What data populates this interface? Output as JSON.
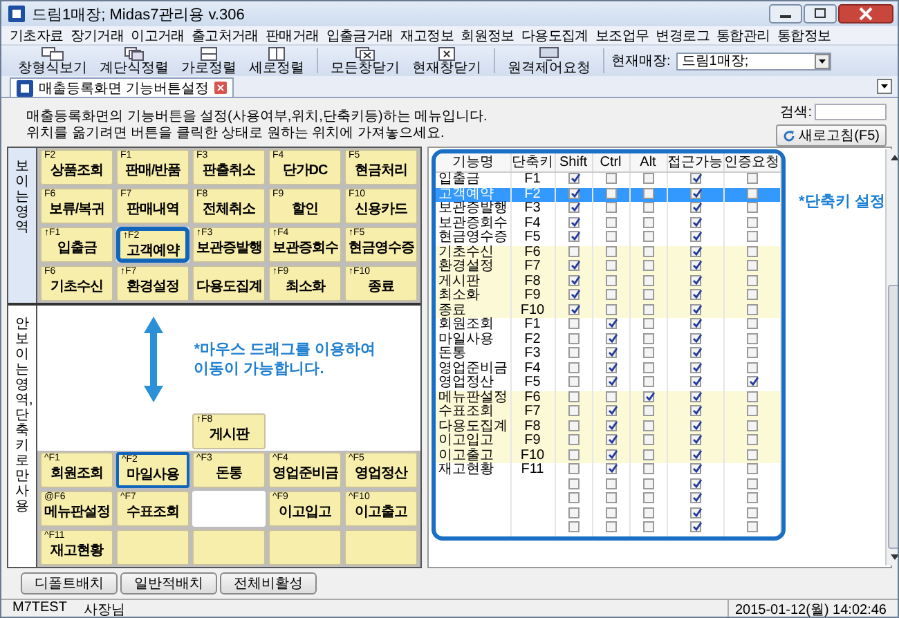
{
  "window": {
    "title": "드림1매장; Midas7관리용 v.306"
  },
  "menu": [
    "기초자료",
    "장기거래",
    "이고거래",
    "출고처거래",
    "판매거래",
    "입출금거래",
    "재고정보",
    "회원정보",
    "다용도집계",
    "보조업무",
    "변경로그",
    "통합관리",
    "통합정보"
  ],
  "toolbar": {
    "groups": [
      [
        "창형식보기",
        "계단식정렬",
        "가로정렬",
        "세로정렬"
      ],
      [
        "모든창닫기",
        "현재창닫기"
      ],
      [
        "원격제어요청"
      ]
    ],
    "store_label": "현재매장:",
    "store_value": "드림1매장;"
  },
  "tab": {
    "title": "매출등록화면 기능버튼설정"
  },
  "description": [
    "매출등록화면의 기능버튼을 설정(사용여부,위치,단축키등)하는 메뉴입니다.",
    "위치를 옮기려면 버튼을 클릭한 상태로 원하는 위치에 가져놓으세요."
  ],
  "search": {
    "label": "검색:"
  },
  "refresh_button": "새로고침(F5)",
  "visible_area": {
    "label": "보이는 영역",
    "rows": [
      [
        {
          "kind": "button",
          "key": "F2",
          "label": "상품조회",
          "selected": false
        },
        {
          "kind": "button",
          "key": "F1",
          "label": "판매/반품",
          "selected": false
        },
        {
          "kind": "button",
          "key": "F3",
          "label": "판출취소",
          "selected": false
        },
        {
          "kind": "button",
          "key": "F4",
          "label": "단가DC",
          "selected": false
        },
        {
          "kind": "button",
          "key": "F5",
          "label": "현금처리",
          "selected": false
        }
      ],
      [
        {
          "kind": "button",
          "key": "F6",
          "label": "보류/복귀",
          "selected": false
        },
        {
          "kind": "button",
          "key": "F7",
          "label": "판매내역",
          "selected": false
        },
        {
          "kind": "button",
          "key": "F8",
          "label": "전체취소",
          "selected": false
        },
        {
          "kind": "button",
          "key": "F9",
          "label": "할인",
          "selected": false
        },
        {
          "kind": "button",
          "key": "F10",
          "label": "신용카드",
          "selected": false
        }
      ],
      [
        {
          "kind": "button",
          "key": "↑F1",
          "label": "입출금",
          "selected": false
        },
        {
          "kind": "target"
        },
        {
          "kind": "button",
          "key": "↑F3",
          "label": "보관증발행",
          "selected": false
        },
        {
          "kind": "button",
          "key": "↑F4",
          "label": "보관증회수",
          "selected": false
        },
        {
          "kind": "button",
          "key": "↑F5",
          "label": "현금영수증",
          "selected": false
        }
      ],
      [
        {
          "kind": "button",
          "key": "F6",
          "label": "기초수신",
          "selected": false
        },
        {
          "kind": "button",
          "key": "↑F7",
          "label": "환경설정",
          "selected": false
        },
        {
          "kind": "button",
          "label": "다용도집계",
          "selected": false
        },
        {
          "kind": "button",
          "key": "↑F9",
          "label": "최소화",
          "selected": false
        },
        {
          "kind": "button",
          "key": "↑F10",
          "label": "종료",
          "selected": false
        }
      ]
    ]
  },
  "dragging_card": {
    "key": "↑F2",
    "label": "고객예약"
  },
  "hidden_area": {
    "label": "안보이는 영역, 단축키로만 사용",
    "hint": "*마우스 드래그를 이용하여 이동이 가능합니다.",
    "rows": [
      [
        {
          "kind": "blank"
        },
        {
          "kind": "blank"
        },
        {
          "kind": "button",
          "key": "↑F8",
          "label": "게시판",
          "selected": false
        },
        {
          "kind": "blank"
        },
        {
          "kind": "blank"
        }
      ],
      [
        {
          "kind": "button",
          "key": "^F1",
          "label": "회원조회",
          "selected": false
        },
        {
          "kind": "button",
          "key": "^F2",
          "label": "마일사용",
          "selected": true
        },
        {
          "kind": "button",
          "key": "^F3",
          "label": "돈통",
          "selected": false
        },
        {
          "kind": "button",
          "key": "^F4",
          "label": "영업준비금",
          "selected": false
        },
        {
          "kind": "button",
          "key": "^F5",
          "label": "영업정산",
          "selected": false
        }
      ],
      [
        {
          "kind": "button",
          "key": "@F6",
          "label": "메뉴판설정",
          "selected": false
        },
        {
          "kind": "button",
          "key": "^F7",
          "label": "수표조회",
          "selected": false
        },
        {
          "kind": "blank"
        },
        {
          "kind": "button",
          "key": "^F9",
          "label": "이고입고",
          "selected": false
        },
        {
          "kind": "button",
          "key": "^F10",
          "label": "이고출고",
          "selected": false
        }
      ],
      [
        {
          "kind": "button",
          "key": "^F11",
          "label": "재고현황",
          "selected": false
        },
        {
          "kind": "empty"
        },
        {
          "kind": "empty"
        },
        {
          "kind": "empty"
        },
        {
          "kind": "empty"
        }
      ]
    ]
  },
  "shortcut_table": {
    "columns": [
      "기능명",
      "단축키",
      "Shift",
      "Ctrl",
      "Alt",
      "접근가능",
      "인증요청"
    ],
    "note": "*단축키 설정",
    "rows": [
      {
        "name": "입출금",
        "key": "F1",
        "shift": true,
        "ctrl": false,
        "alt": false,
        "access": true,
        "auth": false,
        "highlighted": false,
        "selected": false
      },
      {
        "name": "고객예약",
        "key": "F2",
        "shift": true,
        "ctrl": false,
        "alt": false,
        "access": true,
        "auth": false,
        "highlighted": false,
        "selected": true
      },
      {
        "name": "보관증발행",
        "key": "F3",
        "shift": true,
        "ctrl": false,
        "alt": false,
        "access": true,
        "auth": false,
        "highlighted": false,
        "selected": false
      },
      {
        "name": "보관증회수",
        "key": "F4",
        "shift": true,
        "ctrl": false,
        "alt": false,
        "access": true,
        "auth": false,
        "highlighted": false,
        "selected": false
      },
      {
        "name": "현금영수증",
        "key": "F5",
        "shift": true,
        "ctrl": false,
        "alt": false,
        "access": true,
        "auth": false,
        "highlighted": false,
        "selected": false
      },
      {
        "name": "기초수신",
        "key": "F6",
        "shift": false,
        "ctrl": false,
        "alt": false,
        "access": true,
        "auth": false,
        "highlighted": true,
        "selected": false
      },
      {
        "name": "환경설정",
        "key": "F7",
        "shift": true,
        "ctrl": false,
        "alt": false,
        "access": true,
        "auth": false,
        "highlighted": true,
        "selected": false
      },
      {
        "name": "게시판",
        "key": "F8",
        "shift": true,
        "ctrl": false,
        "alt": false,
        "access": true,
        "auth": false,
        "highlighted": true,
        "selected": false
      },
      {
        "name": "최소화",
        "key": "F9",
        "shift": true,
        "ctrl": false,
        "alt": false,
        "access": true,
        "auth": false,
        "highlighted": true,
        "selected": false
      },
      {
        "name": "종료",
        "key": "F10",
        "shift": true,
        "ctrl": false,
        "alt": false,
        "access": true,
        "auth": false,
        "highlighted": true,
        "selected": false
      },
      {
        "name": "회원조회",
        "key": "F1",
        "shift": false,
        "ctrl": true,
        "alt": false,
        "access": true,
        "auth": false,
        "highlighted": false,
        "selected": false
      },
      {
        "name": "마일사용",
        "key": "F2",
        "shift": false,
        "ctrl": true,
        "alt": false,
        "access": true,
        "auth": false,
        "highlighted": false,
        "selected": false
      },
      {
        "name": "돈통",
        "key": "F3",
        "shift": false,
        "ctrl": true,
        "alt": false,
        "access": true,
        "auth": false,
        "highlighted": false,
        "selected": false
      },
      {
        "name": "영업준비금",
        "key": "F4",
        "shift": false,
        "ctrl": true,
        "alt": false,
        "access": true,
        "auth": false,
        "highlighted": false,
        "selected": false
      },
      {
        "name": "영업정산",
        "key": "F5",
        "shift": false,
        "ctrl": true,
        "alt": false,
        "access": true,
        "auth": true,
        "highlighted": false,
        "selected": false
      },
      {
        "name": "메뉴판설정",
        "key": "F6",
        "shift": false,
        "ctrl": false,
        "alt": true,
        "access": true,
        "auth": false,
        "highlighted": true,
        "selected": false
      },
      {
        "name": "수표조회",
        "key": "F7",
        "shift": false,
        "ctrl": true,
        "alt": false,
        "access": true,
        "auth": false,
        "highlighted": true,
        "selected": false
      },
      {
        "name": "다용도집계",
        "key": "F8",
        "shift": false,
        "ctrl": true,
        "alt": false,
        "access": true,
        "auth": false,
        "highlighted": true,
        "selected": false
      },
      {
        "name": "이고입고",
        "key": "F9",
        "shift": false,
        "ctrl": true,
        "alt": false,
        "access": true,
        "auth": false,
        "highlighted": true,
        "selected": false
      },
      {
        "name": "이고출고",
        "key": "F10",
        "shift": false,
        "ctrl": true,
        "alt": false,
        "access": true,
        "auth": false,
        "highlighted": true,
        "selected": false
      },
      {
        "name": "재고현황",
        "key": "F11",
        "shift": false,
        "ctrl": true,
        "alt": false,
        "access": true,
        "auth": false,
        "highlighted": false,
        "selected": false
      },
      {
        "shift": false,
        "ctrl": false,
        "alt": false,
        "access": true,
        "auth": false,
        "highlighted": false,
        "selected": false
      },
      {
        "shift": false,
        "ctrl": false,
        "alt": false,
        "access": true,
        "auth": false,
        "highlighted": false,
        "selected": false
      },
      {
        "shift": false,
        "ctrl": false,
        "alt": false,
        "access": true,
        "auth": false,
        "highlighted": false,
        "selected": false
      },
      {
        "shift": false,
        "ctrl": false,
        "alt": false,
        "access": true,
        "auth": false,
        "highlighted": false,
        "selected": false
      }
    ]
  },
  "footer_buttons": [
    "디폴트배치",
    "일반적배치",
    "전체비활성"
  ],
  "status_bar": {
    "user": "M7TEST",
    "role": "사장님",
    "datetime": "2015-01-12(월) 14:02:46"
  }
}
